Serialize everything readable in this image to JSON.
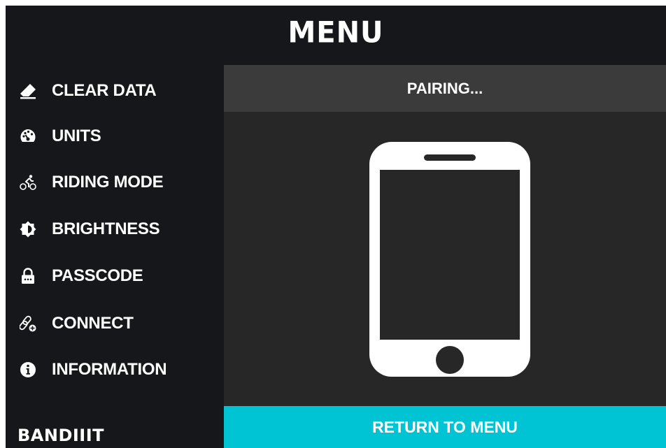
{
  "header": {
    "title": "MENU"
  },
  "sidebar": {
    "items": [
      {
        "label": "CLEAR DATA",
        "icon": "eraser-icon"
      },
      {
        "label": "UNITS",
        "icon": "speedometer-icon"
      },
      {
        "label": "RIDING MODE",
        "icon": "cyclist-icon"
      },
      {
        "label": "BRIGHTNESS",
        "icon": "brightness-icon"
      },
      {
        "label": "PASSCODE",
        "icon": "padlock-icon"
      },
      {
        "label": "CONNECT",
        "icon": "link-add-icon"
      },
      {
        "label": "INFORMATION",
        "icon": "info-icon"
      }
    ],
    "brand": "BANDIIIT"
  },
  "panel": {
    "title": "PAIRING...",
    "illustration": "smartphone-icon",
    "return_label": "RETURN TO MENU"
  },
  "colors": {
    "background": "#16171b",
    "panel": "#272727",
    "panel_header": "#3b3b3b",
    "accent": "#00c4d4",
    "text": "#ffffff"
  }
}
